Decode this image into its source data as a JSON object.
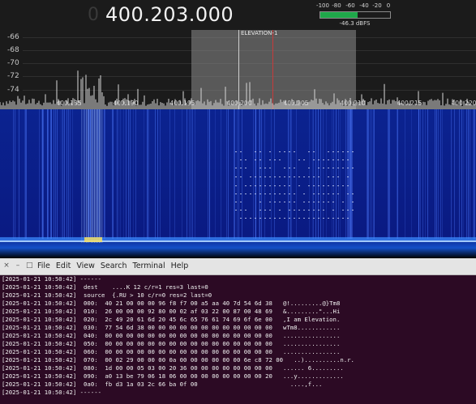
{
  "sdr": {
    "frequency_prefix": "0",
    "frequency": "400.203.000",
    "meter": {
      "ticks": [
        "-100",
        "-80",
        "-60",
        "-40",
        "-20",
        "0"
      ],
      "level_fraction": 0.54,
      "readout": "-46.3 dBFS",
      "color": "#1fa84a"
    },
    "y_labels": [
      "-66",
      "-68",
      "-70",
      "-72",
      "-74"
    ],
    "x_labels": [
      "400.185",
      "400.190",
      "400.195",
      "400.200",
      "400.205",
      "400.210",
      "400.215",
      "400.220"
    ],
    "vfo_label": "ELEVATION-1",
    "vfo_color": "#c83a3a"
  },
  "terminal": {
    "menu": [
      "File",
      "Edit",
      "View",
      "Search",
      "Terminal",
      "Help"
    ],
    "background": "#2c0a24",
    "lines": [
      "[2025-01-21 10:50:42] ------",
      "[2025-01-21 10:50:42]  dest    ....K 12 c/r=1 res=3 last=0",
      "[2025-01-21 10:50:42]  source  {.RU > 10 c/r=0 res=2 last=0",
      "[2025-01-21 10:50:42]  000:  40 21 00 00 00 96 f8 f7 00 a5 aa 40 7d 54 6d 38   @!.........@}Tm8",
      "[2025-01-21 10:50:42]  010:  26 00 00 00 92 80 00 02 af 03 22 00 87 00 48 69   &.........\"...Hi",
      "[2025-01-21 10:50:42]  020:  2c 49 20 61 6d 20 45 6c 65 76 61 74 69 6f 6e 00   ,I am Elevation.",
      "[2025-01-21 10:50:42]  030:  77 54 6d 38 00 00 00 00 00 00 00 00 00 00 00 00   wTm8............",
      "[2025-01-21 10:50:42]  040:  00 00 00 00 00 00 00 00 00 00 00 00 00 00 00 00   ................",
      "[2025-01-21 10:50:42]  050:  00 00 00 00 00 00 00 00 00 00 00 00 00 00 00 00   ................",
      "[2025-01-21 10:50:42]  060:  00 00 00 00 00 00 00 00 00 00 00 00 00 00 00 00   ................",
      "[2025-01-21 10:50:42]  070:  00 02 29 00 00 00 0a 00 00 00 00 00 00 6e c8 72 00   ..)..........n.r.",
      "[2025-01-21 10:50:42]  080:  1d 00 00 05 03 00 20 36 00 00 00 00 00 00 00 00   ...... 6.........",
      "[2025-01-21 10:50:42]  090:  a0 13 be 79 06 18 06 00 00 00 00 00 00 00 00 20   ...y.............",
      "[2025-01-21 10:50:42]  0a0:  fb d3 1a 03 2c 66 ba 0f 00                          ....,f...",
      "[2025-01-21 10:50:42] ------"
    ]
  }
}
